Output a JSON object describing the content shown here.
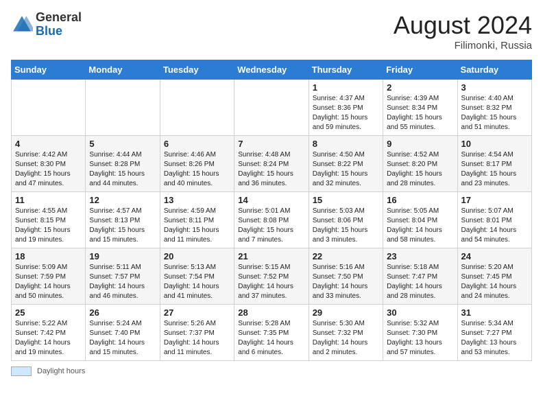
{
  "header": {
    "logo_general": "General",
    "logo_blue": "Blue",
    "month_year": "August 2024",
    "location": "Filimonki, Russia"
  },
  "footer": {
    "daylight_label": "Daylight hours"
  },
  "days_of_week": [
    "Sunday",
    "Monday",
    "Tuesday",
    "Wednesday",
    "Thursday",
    "Friday",
    "Saturday"
  ],
  "weeks": [
    [
      {
        "day": "",
        "info": ""
      },
      {
        "day": "",
        "info": ""
      },
      {
        "day": "",
        "info": ""
      },
      {
        "day": "",
        "info": ""
      },
      {
        "day": "1",
        "info": "Sunrise: 4:37 AM\nSunset: 8:36 PM\nDaylight: 15 hours and 59 minutes."
      },
      {
        "day": "2",
        "info": "Sunrise: 4:39 AM\nSunset: 8:34 PM\nDaylight: 15 hours and 55 minutes."
      },
      {
        "day": "3",
        "info": "Sunrise: 4:40 AM\nSunset: 8:32 PM\nDaylight: 15 hours and 51 minutes."
      }
    ],
    [
      {
        "day": "4",
        "info": "Sunrise: 4:42 AM\nSunset: 8:30 PM\nDaylight: 15 hours and 47 minutes."
      },
      {
        "day": "5",
        "info": "Sunrise: 4:44 AM\nSunset: 8:28 PM\nDaylight: 15 hours and 44 minutes."
      },
      {
        "day": "6",
        "info": "Sunrise: 4:46 AM\nSunset: 8:26 PM\nDaylight: 15 hours and 40 minutes."
      },
      {
        "day": "7",
        "info": "Sunrise: 4:48 AM\nSunset: 8:24 PM\nDaylight: 15 hours and 36 minutes."
      },
      {
        "day": "8",
        "info": "Sunrise: 4:50 AM\nSunset: 8:22 PM\nDaylight: 15 hours and 32 minutes."
      },
      {
        "day": "9",
        "info": "Sunrise: 4:52 AM\nSunset: 8:20 PM\nDaylight: 15 hours and 28 minutes."
      },
      {
        "day": "10",
        "info": "Sunrise: 4:54 AM\nSunset: 8:17 PM\nDaylight: 15 hours and 23 minutes."
      }
    ],
    [
      {
        "day": "11",
        "info": "Sunrise: 4:55 AM\nSunset: 8:15 PM\nDaylight: 15 hours and 19 minutes."
      },
      {
        "day": "12",
        "info": "Sunrise: 4:57 AM\nSunset: 8:13 PM\nDaylight: 15 hours and 15 minutes."
      },
      {
        "day": "13",
        "info": "Sunrise: 4:59 AM\nSunset: 8:11 PM\nDaylight: 15 hours and 11 minutes."
      },
      {
        "day": "14",
        "info": "Sunrise: 5:01 AM\nSunset: 8:08 PM\nDaylight: 15 hours and 7 minutes."
      },
      {
        "day": "15",
        "info": "Sunrise: 5:03 AM\nSunset: 8:06 PM\nDaylight: 15 hours and 3 minutes."
      },
      {
        "day": "16",
        "info": "Sunrise: 5:05 AM\nSunset: 8:04 PM\nDaylight: 14 hours and 58 minutes."
      },
      {
        "day": "17",
        "info": "Sunrise: 5:07 AM\nSunset: 8:01 PM\nDaylight: 14 hours and 54 minutes."
      }
    ],
    [
      {
        "day": "18",
        "info": "Sunrise: 5:09 AM\nSunset: 7:59 PM\nDaylight: 14 hours and 50 minutes."
      },
      {
        "day": "19",
        "info": "Sunrise: 5:11 AM\nSunset: 7:57 PM\nDaylight: 14 hours and 46 minutes."
      },
      {
        "day": "20",
        "info": "Sunrise: 5:13 AM\nSunset: 7:54 PM\nDaylight: 14 hours and 41 minutes."
      },
      {
        "day": "21",
        "info": "Sunrise: 5:15 AM\nSunset: 7:52 PM\nDaylight: 14 hours and 37 minutes."
      },
      {
        "day": "22",
        "info": "Sunrise: 5:16 AM\nSunset: 7:50 PM\nDaylight: 14 hours and 33 minutes."
      },
      {
        "day": "23",
        "info": "Sunrise: 5:18 AM\nSunset: 7:47 PM\nDaylight: 14 hours and 28 minutes."
      },
      {
        "day": "24",
        "info": "Sunrise: 5:20 AM\nSunset: 7:45 PM\nDaylight: 14 hours and 24 minutes."
      }
    ],
    [
      {
        "day": "25",
        "info": "Sunrise: 5:22 AM\nSunset: 7:42 PM\nDaylight: 14 hours and 19 minutes."
      },
      {
        "day": "26",
        "info": "Sunrise: 5:24 AM\nSunset: 7:40 PM\nDaylight: 14 hours and 15 minutes."
      },
      {
        "day": "27",
        "info": "Sunrise: 5:26 AM\nSunset: 7:37 PM\nDaylight: 14 hours and 11 minutes."
      },
      {
        "day": "28",
        "info": "Sunrise: 5:28 AM\nSunset: 7:35 PM\nDaylight: 14 hours and 6 minutes."
      },
      {
        "day": "29",
        "info": "Sunrise: 5:30 AM\nSunset: 7:32 PM\nDaylight: 14 hours and 2 minutes."
      },
      {
        "day": "30",
        "info": "Sunrise: 5:32 AM\nSunset: 7:30 PM\nDaylight: 13 hours and 57 minutes."
      },
      {
        "day": "31",
        "info": "Sunrise: 5:34 AM\nSunset: 7:27 PM\nDaylight: 13 hours and 53 minutes."
      }
    ]
  ]
}
